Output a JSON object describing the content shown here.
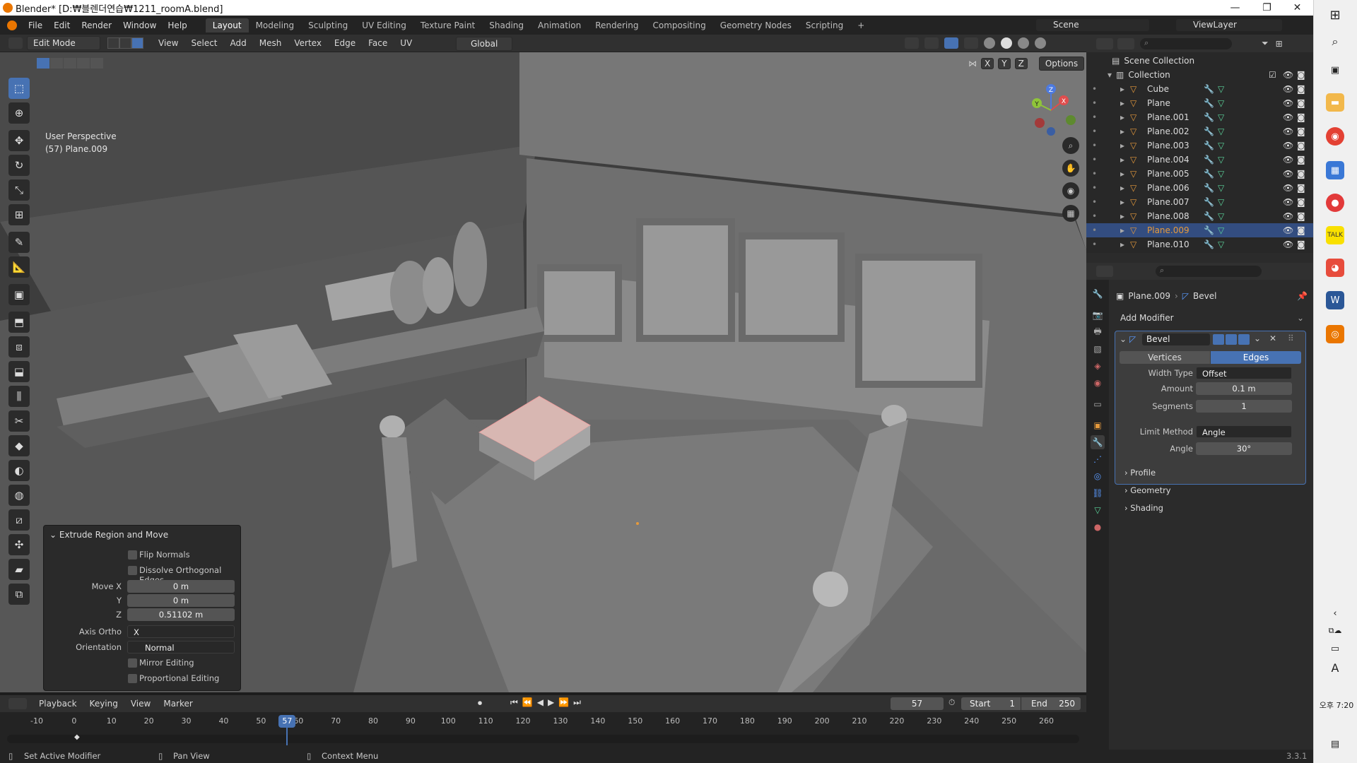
{
  "window": {
    "title": "Blender* [D:₩블렌더연습₩1211_roomA.blend]",
    "controls": [
      "—",
      "❐",
      "✕"
    ]
  },
  "menu": [
    "File",
    "Edit",
    "Render",
    "Window",
    "Help"
  ],
  "workspaces": [
    "Layout",
    "Modeling",
    "Sculpting",
    "UV Editing",
    "Texture Paint",
    "Shading",
    "Animation",
    "Rendering",
    "Compositing",
    "Geometry Nodes",
    "Scripting",
    "+"
  ],
  "scene": {
    "name": "Scene",
    "view_layer": "ViewLayer"
  },
  "viewport_header": {
    "mode": "Edit Mode",
    "menus": [
      "View",
      "Select",
      "Add",
      "Mesh",
      "Vertex",
      "Edge",
      "Face",
      "UV"
    ],
    "orientation": "Global",
    "options": "Options",
    "axes": [
      "X",
      "Y",
      "Z"
    ]
  },
  "viewport": {
    "info_line1": "User Perspective",
    "info_line2": "(57) Plane.009",
    "gizmo": {
      "x": "X",
      "y": "Y",
      "z": "Z"
    }
  },
  "redo_panel": {
    "title": "Extrude Region and Move",
    "flip_normals": "Flip Normals",
    "dissolve": "Dissolve Orthogonal Edges",
    "move_x_label": "Move X",
    "move_x": "0 m",
    "y_label": "Y",
    "y": "0 m",
    "z_label": "Z",
    "z": "0.51102 m",
    "axis_ortho_label": "Axis Ortho",
    "axis_ortho": "X",
    "orientation_label": "Orientation",
    "orientation": "Normal",
    "mirror": "Mirror Editing",
    "proportional": "Proportional Editing"
  },
  "outliner": {
    "scene_collection": "Scene Collection",
    "collection": "Collection",
    "items": [
      {
        "name": "Cube",
        "selected": false
      },
      {
        "name": "Plane",
        "selected": false
      },
      {
        "name": "Plane.001",
        "selected": false
      },
      {
        "name": "Plane.002",
        "selected": false
      },
      {
        "name": "Plane.003",
        "selected": false
      },
      {
        "name": "Plane.004",
        "selected": false
      },
      {
        "name": "Plane.005",
        "selected": false
      },
      {
        "name": "Plane.006",
        "selected": false
      },
      {
        "name": "Plane.007",
        "selected": false
      },
      {
        "name": "Plane.008",
        "selected": false
      },
      {
        "name": "Plane.009",
        "selected": true
      },
      {
        "name": "Plane.010",
        "selected": false
      }
    ]
  },
  "properties": {
    "breadcrumb_object": "Plane.009",
    "breadcrumb_modifier": "Bevel",
    "add_modifier": "Add Modifier",
    "modifier_name": "Bevel",
    "tab_vertices": "Vertices",
    "tab_edges": "Edges",
    "width_type_label": "Width Type",
    "width_type": "Offset",
    "amount_label": "Amount",
    "amount": "0.1 m",
    "segments_label": "Segments",
    "segments": "1",
    "limit_label": "Limit Method",
    "limit": "Angle",
    "angle_label": "Angle",
    "angle": "30°",
    "sub_profile": "Profile",
    "sub_geometry": "Geometry",
    "sub_shading": "Shading"
  },
  "timeline": {
    "menus": [
      "Playback",
      "Keying",
      "View",
      "Marker"
    ],
    "current_frame": "57",
    "start_label": "Start",
    "start": "1",
    "end_label": "End",
    "end": "250",
    "ticks": [
      "-10",
      "0",
      "10",
      "20",
      "30",
      "40",
      "50",
      "60",
      "70",
      "80",
      "90",
      "100",
      "110",
      "120",
      "130",
      "140",
      "150",
      "160",
      "170",
      "180",
      "190",
      "200",
      "210",
      "220",
      "230",
      "240",
      "250",
      "260"
    ],
    "frame_current_value": 57
  },
  "status": {
    "left": "Set Active Modifier",
    "mid": "Pan View",
    "right": "Context Menu",
    "version": "3.3.1"
  },
  "taskbar": {
    "time_line1": "오후 7:20",
    "lang": "A"
  },
  "colors": {
    "accent": "#4772b3",
    "selected_row": "#334d80",
    "active_object": "#e69a3c",
    "blender_orange": "#ea7600"
  }
}
